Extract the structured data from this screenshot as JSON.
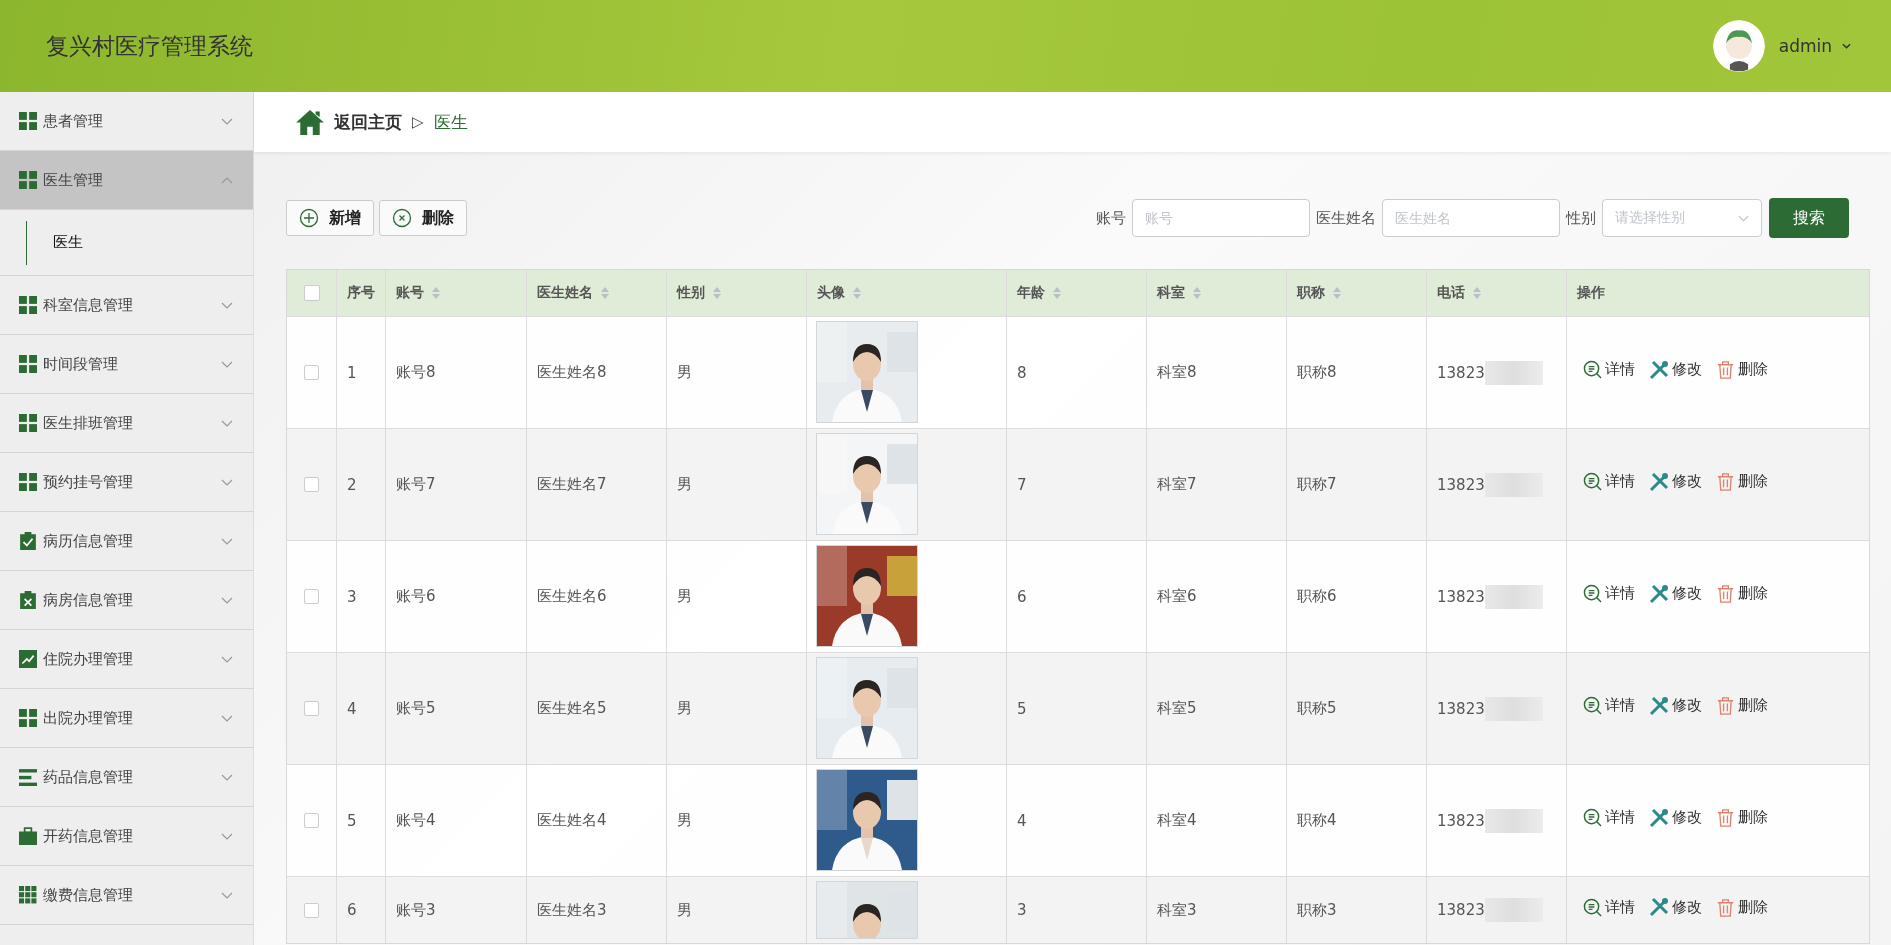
{
  "header": {
    "title": "复兴村医疗管理系统",
    "user": "admin"
  },
  "sidebar": {
    "items": [
      {
        "label": "患者管理",
        "expanded": false
      },
      {
        "label": "医生管理",
        "expanded": true,
        "children": [
          {
            "label": "医生",
            "selected": true
          }
        ]
      },
      {
        "label": "科室信息管理",
        "expanded": false
      },
      {
        "label": "时间段管理",
        "expanded": false
      },
      {
        "label": "医生排班管理",
        "expanded": false
      },
      {
        "label": "预约挂号管理",
        "expanded": false
      },
      {
        "label": "病历信息管理",
        "expanded": false
      },
      {
        "label": "病房信息管理",
        "expanded": false
      },
      {
        "label": "住院办理管理",
        "expanded": false
      },
      {
        "label": "出院办理管理",
        "expanded": false
      },
      {
        "label": "药品信息管理",
        "expanded": false
      },
      {
        "label": "开药信息管理",
        "expanded": false
      },
      {
        "label": "缴费信息管理",
        "expanded": false
      }
    ]
  },
  "breadcrumb": {
    "home": "返回主页",
    "separator": "▷",
    "current": "医生"
  },
  "toolbar": {
    "buttons": [
      {
        "label": "新增",
        "kind": "add"
      },
      {
        "label": "删除",
        "kind": "remove"
      }
    ]
  },
  "search": {
    "fields": [
      {
        "label": "账号",
        "placeholder": "账号",
        "kind": "text"
      },
      {
        "label": "医生姓名",
        "placeholder": "医生姓名",
        "kind": "text"
      },
      {
        "label": "性别",
        "placeholder": "请选择性别",
        "kind": "select"
      }
    ],
    "button": "搜索"
  },
  "table": {
    "all_checked": false,
    "columns": [
      {
        "label": "序号",
        "sortable": false
      },
      {
        "label": "账号",
        "sortable": true
      },
      {
        "label": "医生姓名",
        "sortable": true
      },
      {
        "label": "性别",
        "sortable": true
      },
      {
        "label": "头像",
        "sortable": true
      },
      {
        "label": "年龄",
        "sortable": true
      },
      {
        "label": "科室",
        "sortable": true
      },
      {
        "label": "职称",
        "sortable": true
      },
      {
        "label": "电话",
        "sortable": true
      },
      {
        "label": "操作",
        "sortable": false
      }
    ],
    "rows": [
      {
        "checked": false,
        "index": "1",
        "account": "账号8",
        "name": "医生姓名8",
        "gender": "男",
        "age": "8",
        "dept": "科室8",
        "title": "职称8",
        "phone": "13823",
        "actions": [
          "详情",
          "修改",
          "删除"
        ]
      },
      {
        "checked": false,
        "index": "2",
        "account": "账号7",
        "name": "医生姓名7",
        "gender": "男",
        "age": "7",
        "dept": "科室7",
        "title": "职称7",
        "phone": "13823",
        "actions": [
          "详情",
          "修改",
          "删除"
        ]
      },
      {
        "checked": false,
        "index": "3",
        "account": "账号6",
        "name": "医生姓名6",
        "gender": "男",
        "age": "6",
        "dept": "科室6",
        "title": "职称6",
        "phone": "13823",
        "actions": [
          "详情",
          "修改",
          "删除"
        ]
      },
      {
        "checked": false,
        "index": "4",
        "account": "账号5",
        "name": "医生姓名5",
        "gender": "男",
        "age": "5",
        "dept": "科室5",
        "title": "职称5",
        "phone": "13823",
        "actions": [
          "详情",
          "修改",
          "删除"
        ]
      },
      {
        "checked": false,
        "index": "5",
        "account": "账号4",
        "name": "医生姓名4",
        "gender": "男",
        "age": "4",
        "dept": "科室4",
        "title": "职称4",
        "phone": "13823",
        "actions": [
          "详情",
          "修改",
          "删除"
        ]
      },
      {
        "checked": false,
        "index": "6",
        "account": "账号3",
        "name": "医生姓名3",
        "gender": "男",
        "age": "3",
        "dept": "科室3",
        "title": "职称3",
        "phone": "13823",
        "actions": [
          "详情",
          "修改",
          "删除"
        ]
      }
    ]
  }
}
